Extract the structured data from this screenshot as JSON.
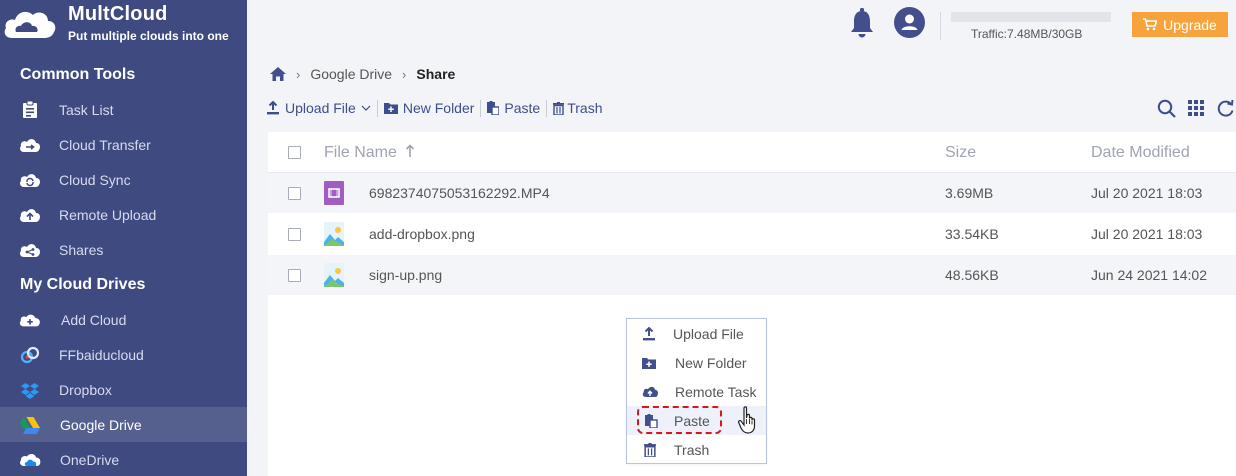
{
  "brand": {
    "name": "MultCloud",
    "tagline": "Put multiple clouds into one"
  },
  "sidebar": {
    "common_tools_title": "Common Tools",
    "common_tools": [
      {
        "label": "Task List",
        "icon": "task-list-icon"
      },
      {
        "label": "Cloud Transfer",
        "icon": "cloud-transfer-icon"
      },
      {
        "label": "Cloud Sync",
        "icon": "cloud-sync-icon"
      },
      {
        "label": "Remote Upload",
        "icon": "remote-upload-icon"
      },
      {
        "label": "Shares",
        "icon": "shares-icon"
      }
    ],
    "my_drives_title": "My Cloud Drives",
    "my_drives": [
      {
        "label": "Add Cloud",
        "icon": "add-cloud-icon"
      },
      {
        "label": "FFbaiducloud",
        "icon": "baidu-cloud-icon"
      },
      {
        "label": "Dropbox",
        "icon": "dropbox-icon"
      },
      {
        "label": "Google Drive",
        "icon": "google-drive-icon",
        "active": true
      },
      {
        "label": "OneDrive",
        "icon": "onedrive-icon"
      }
    ]
  },
  "topbar": {
    "traffic": "Traffic:7.48MB/30GB",
    "upgrade_label": "Upgrade"
  },
  "breadcrumb": {
    "root": "Google Drive",
    "current": "Share"
  },
  "toolbar": {
    "upload_label": "Upload File",
    "new_folder_label": "New Folder",
    "paste_label": "Paste",
    "trash_label": "Trash"
  },
  "table": {
    "columns": {
      "name": "File Name",
      "size": "Size",
      "date": "Date Modified"
    },
    "rows": [
      {
        "name": "6982374075053162292.MP4",
        "size": "3.69MB",
        "date": "Jul 20 2021 18:03",
        "type": "video"
      },
      {
        "name": "add-dropbox.png",
        "size": "33.54KB",
        "date": "Jul 20 2021 18:03",
        "type": "image"
      },
      {
        "name": "sign-up.png",
        "size": "48.56KB",
        "date": "Jun 24 2021 14:02",
        "type": "image"
      }
    ]
  },
  "context_menu": [
    {
      "label": "Upload File",
      "icon": "upload-icon"
    },
    {
      "label": "New Folder",
      "icon": "new-folder-icon"
    },
    {
      "label": "Remote Task",
      "icon": "remote-task-icon"
    },
    {
      "label": "Paste",
      "icon": "paste-icon"
    },
    {
      "label": "Trash",
      "icon": "trash-icon"
    }
  ],
  "colors": {
    "sidebar_bg": "#3f4a80",
    "accent": "#3e4e8d",
    "upgrade_bg": "#f7a33b",
    "highlight": "#d8171d"
  }
}
